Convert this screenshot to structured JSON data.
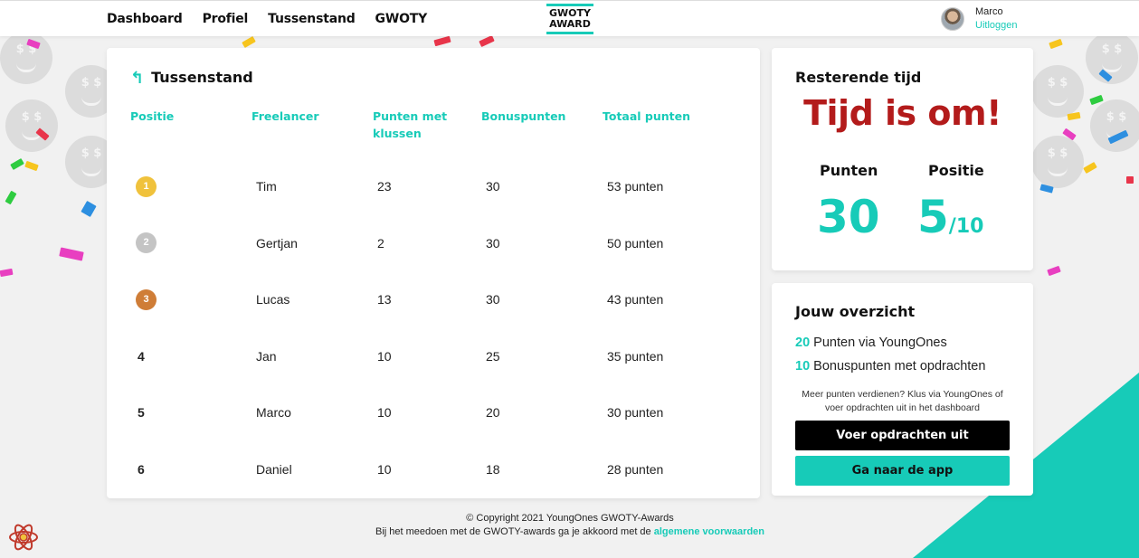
{
  "header": {
    "nav": [
      {
        "label": "Dashboard"
      },
      {
        "label": "Profiel"
      },
      {
        "label": "Tussenstand"
      },
      {
        "label": "GWOTY"
      }
    ],
    "logo_line1": "GWOTY",
    "logo_line2": "AWARD",
    "user_name": "Marco",
    "logout_label": "Uitloggen"
  },
  "standings": {
    "title": "Tussenstand",
    "columns": [
      "Positie",
      "Freelancer",
      "Punten met klussen",
      "Bonuspunten",
      "Totaal punten"
    ],
    "rows": [
      {
        "position": "1",
        "name": "Tim",
        "job_points": "23",
        "bonus": "30",
        "total": "53 punten"
      },
      {
        "position": "2",
        "name": "Gertjan",
        "job_points": "2",
        "bonus": "30",
        "total": "50 punten"
      },
      {
        "position": "3",
        "name": "Lucas",
        "job_points": "13",
        "bonus": "30",
        "total": "43 punten"
      },
      {
        "position": "4",
        "name": "Jan",
        "job_points": "10",
        "bonus": "25",
        "total": "35 punten"
      },
      {
        "position": "5",
        "name": "Marco",
        "job_points": "10",
        "bonus": "20",
        "total": "30 punten"
      },
      {
        "position": "6",
        "name": "Daniel",
        "job_points": "10",
        "bonus": "18",
        "total": "28 punten"
      }
    ]
  },
  "time_card": {
    "title": "Resterende tijd",
    "status": "Tijd is om!",
    "points_label": "Punten",
    "position_label": "Positie",
    "points_value": "30",
    "position_value": "5",
    "position_total": "/10"
  },
  "overview": {
    "title": "Jouw overzicht",
    "line1_num": "20",
    "line1_text": "Punten via YoungOnes",
    "line2_num": "10",
    "line2_text": "Bonuspunten met opdrachten",
    "note": "Meer punten verdienen? Klus via YoungOnes of voer opdrachten uit in het dashboard",
    "btn_tasks": "Voer opdrachten uit",
    "btn_app": "Ga naar de app"
  },
  "footer": {
    "copyright": "© Copyright 2021 YoungOnes GWOTY-Awards",
    "terms_text": "Bij het meedoen met de GWOTY-awards ga je akkoord met de",
    "terms_link": "algemene voorwaarden"
  },
  "colors": {
    "accent": "#17cbb8",
    "alert": "#b31b1b",
    "gold": "#f0c23c",
    "silver": "#c4c4c4",
    "bronze": "#cf7d37"
  },
  "icons": [
    "back-arrow-icon",
    "react-logo-icon",
    "user-avatar"
  ]
}
